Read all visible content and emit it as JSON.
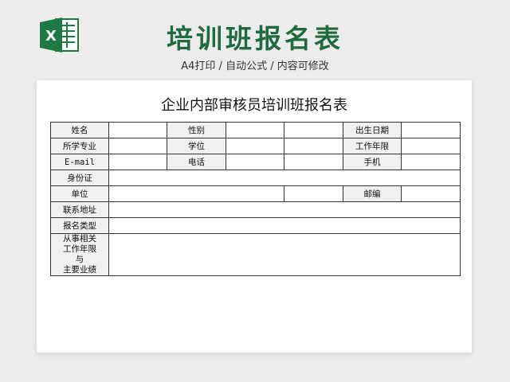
{
  "header": {
    "icon": "excel-icon",
    "title": "培训班报名表",
    "subtitle": "A4打印 / 自动公式 / 内容可修改"
  },
  "sheet": {
    "title": "企业内部审核员培训班报名表",
    "labels": {
      "name": "姓名",
      "gender": "性别",
      "birthdate": "出生日期",
      "major": "所学专业",
      "degree": "学位",
      "work_years": "工作年限",
      "email": "E-mail",
      "phone": "电话",
      "mobile": "手机",
      "id_card": "身份证",
      "unit": "单位",
      "postcode": "邮编",
      "address": "联系地址",
      "enroll_type": "报名类型",
      "experience": [
        "从事相关",
        "工作年限",
        "与",
        "主要业绩"
      ]
    }
  },
  "colors": {
    "brand_green": "#1f6b3d",
    "excel_green": "#1d7a45",
    "label_bg": "#f0f0f0"
  }
}
